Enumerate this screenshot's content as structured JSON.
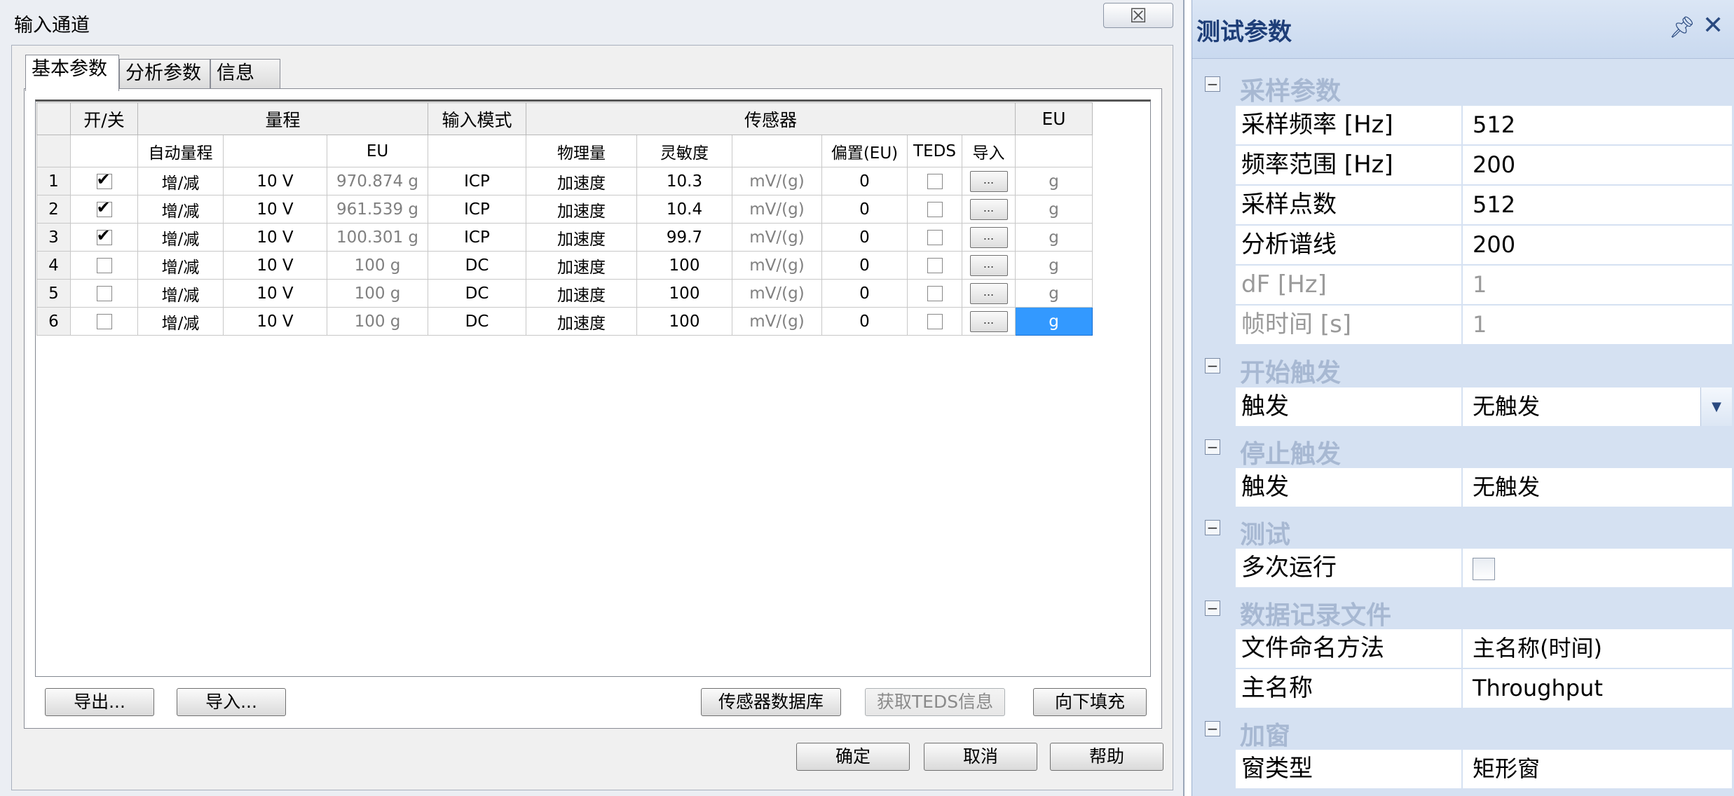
{
  "dialog": {
    "title": "输入通道",
    "close_glyph": "☒",
    "tabs": [
      "基本参数",
      "分析参数",
      "信息"
    ],
    "grid": {
      "header_row1": {
        "on_off": "开/关",
        "range": "量程",
        "input_mode": "输入模式",
        "sensor": "传感器",
        "eu": "EU"
      },
      "header_row2": {
        "auto_range": "自动量程",
        "eu": "EU",
        "physical": "物理量",
        "sensitivity": "灵敏度",
        "bias": "偏置(EU)",
        "teds": "TEDS",
        "import": "导入"
      },
      "rows": [
        {
          "no": "1",
          "checked": true,
          "auto": "增/减",
          "range": "10 V",
          "eu_val": "970.874 g",
          "mode": "ICP",
          "phys": "加速度",
          "sens": "10.3",
          "unit": "mV/(g)",
          "bias": "0",
          "dots": "...",
          "eu": "g"
        },
        {
          "no": "2",
          "checked": true,
          "auto": "增/减",
          "range": "10 V",
          "eu_val": "961.539 g",
          "mode": "ICP",
          "phys": "加速度",
          "sens": "10.4",
          "unit": "mV/(g)",
          "bias": "0",
          "dots": "...",
          "eu": "g"
        },
        {
          "no": "3",
          "checked": true,
          "auto": "增/减",
          "range": "10 V",
          "eu_val": "100.301 g",
          "mode": "ICP",
          "phys": "加速度",
          "sens": "99.7",
          "unit": "mV/(g)",
          "bias": "0",
          "dots": "...",
          "eu": "g"
        },
        {
          "no": "4",
          "checked": false,
          "auto": "增/减",
          "range": "10 V",
          "eu_val": "100 g",
          "mode": "DC",
          "phys": "加速度",
          "sens": "100",
          "unit": "mV/(g)",
          "bias": "0",
          "dots": "...",
          "eu": "g"
        },
        {
          "no": "5",
          "checked": false,
          "auto": "增/减",
          "range": "10 V",
          "eu_val": "100 g",
          "mode": "DC",
          "phys": "加速度",
          "sens": "100",
          "unit": "mV/(g)",
          "bias": "0",
          "dots": "...",
          "eu": "g"
        },
        {
          "no": "6",
          "checked": false,
          "auto": "增/减",
          "range": "10 V",
          "eu_val": "100 g",
          "mode": "DC",
          "phys": "加速度",
          "sens": "100",
          "unit": "mV/(g)",
          "bias": "0",
          "dots": "...",
          "eu": "g"
        }
      ]
    },
    "buttons": {
      "export": "导出...",
      "import": "导入...",
      "sensor_db": "传感器数据库",
      "get_teds": "获取TEDS信息",
      "fill_down": "向下填充",
      "ok": "确定",
      "cancel": "取消",
      "help": "帮助"
    }
  },
  "props": {
    "title": "测试参数",
    "pin_glyph": "ᵖ",
    "close_glyph": "✕",
    "categories": {
      "sampling": {
        "label": "采样参数",
        "items": [
          {
            "name": "采样频率 [Hz]",
            "value": "512"
          },
          {
            "name": "频率范围 [Hz]",
            "value": "200"
          },
          {
            "name": "采样点数",
            "value": "512"
          },
          {
            "name": "分析谱线",
            "value": "200"
          },
          {
            "name": "dF [Hz]",
            "value": "1"
          },
          {
            "name": "帧时间 [s]",
            "value": "1"
          }
        ]
      },
      "start_trigger": {
        "label": "开始触发",
        "item": {
          "name": "触发",
          "value": "无触发"
        }
      },
      "stop_trigger": {
        "label": "停止触发",
        "item": {
          "name": "触发",
          "value": "无触发"
        }
      },
      "test": {
        "label": "测试",
        "item": {
          "name": "多次运行",
          "checked": false
        }
      },
      "record": {
        "label": "数据记录文件",
        "items": [
          {
            "name": "文件命名方法",
            "value": "主名称(时间)"
          },
          {
            "name": "主名称",
            "value": "Throughput"
          }
        ]
      },
      "window": {
        "label": "加窗",
        "item": {
          "name": "窗类型",
          "value": "矩形窗"
        }
      }
    }
  }
}
